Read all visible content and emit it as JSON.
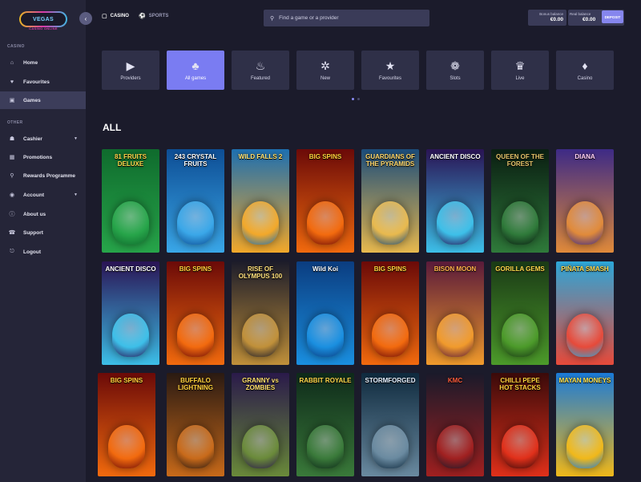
{
  "logo": {
    "text": "VEGAS",
    "sub": "CASINO ONLINE"
  },
  "sidebar": {
    "casino_label": "CASINO",
    "other_label": "OTHER",
    "items": [
      {
        "label": "Home",
        "icon": "home-icon"
      },
      {
        "label": "Favourites",
        "icon": "heart-icon"
      },
      {
        "label": "Games",
        "icon": "games-icon"
      },
      {
        "label": "Cashier",
        "icon": "cashier-icon"
      },
      {
        "label": "Promotions",
        "icon": "gift-icon"
      },
      {
        "label": "Rewards Programme",
        "icon": "trophy-icon"
      },
      {
        "label": "Account",
        "icon": "account-icon"
      },
      {
        "label": "About us",
        "icon": "info-icon"
      },
      {
        "label": "Support",
        "icon": "support-icon"
      },
      {
        "label": "Logout",
        "icon": "logout-icon"
      }
    ]
  },
  "topbar": {
    "casino_tab": "CASINO",
    "sports_tab": "SPORTS",
    "search_placeholder": "Find a game or a provider",
    "bonus_balance_label": "Bonus balance",
    "bonus_balance_value": "€0.00",
    "real_balance_label": "Real balance",
    "real_balance_value": "€0.00",
    "deposit_label": "DEPOSIT"
  },
  "categories": [
    {
      "label": "Providers",
      "icon": "providers-icon"
    },
    {
      "label": "All games",
      "icon": "all-games-icon"
    },
    {
      "label": "Featured",
      "icon": "flame-icon"
    },
    {
      "label": "New",
      "icon": "new-icon"
    },
    {
      "label": "Favourites",
      "icon": "star-icon"
    },
    {
      "label": "Slots",
      "icon": "cherry-icon"
    },
    {
      "label": "Live",
      "icon": "live-icon"
    },
    {
      "label": "Casino",
      "icon": "chips-icon"
    }
  ],
  "section_title": "ALL",
  "games": [
    {
      "title": "81 FRUITS DELUXE",
      "colors": [
        "#0f6b2d",
        "#27a54a"
      ],
      "title_color": "#ffd64a"
    },
    {
      "title": "243 CRYSTAL FRUITS",
      "colors": [
        "#0d4d94",
        "#3aa7e8"
      ],
      "title_color": "#ffffff"
    },
    {
      "title": "WILD FALLS 2",
      "colors": [
        "#1d6fb0",
        "#f2a82a"
      ],
      "title_color": "#ffe170"
    },
    {
      "title": "BIG SPINS",
      "colors": [
        "#6b0a08",
        "#f26a0e"
      ],
      "title_color": "#ffd23c"
    },
    {
      "title": "GUARDIANS OF THE PYRAMIDS",
      "colors": [
        "#1b4c7a",
        "#e8b94e"
      ],
      "title_color": "#ffd76a"
    },
    {
      "title": "ANCIENT DISCO",
      "colors": [
        "#2a1455",
        "#3dbfe8"
      ],
      "title_color": "#ffffff"
    },
    {
      "title": "QUEEN OF THE FOREST",
      "colors": [
        "#0a1e12",
        "#2f7a3a"
      ],
      "title_color": "#e6c36a"
    },
    {
      "title": "DIANA",
      "colors": [
        "#3d2a86",
        "#e08a3a"
      ],
      "title_color": "#ffd0f4"
    },
    {
      "title": "ANCIENT DISCO",
      "colors": [
        "#2a1455",
        "#3dbfe8"
      ],
      "title_color": "#ffffff"
    },
    {
      "title": "BIG SPINS",
      "colors": [
        "#6b0a08",
        "#f26a0e"
      ],
      "title_color": "#ffd23c"
    },
    {
      "title": "RISE OF OLYMPUS 100",
      "colors": [
        "#1c1c2a",
        "#c0903a"
      ],
      "title_color": "#ffe07a"
    },
    {
      "title": "Wild Koi",
      "colors": [
        "#0b3d80",
        "#1a8fe0"
      ],
      "title_color": "#ffffff"
    },
    {
      "title": "BIG SPINS",
      "colors": [
        "#6b0a08",
        "#f26a0e"
      ],
      "title_color": "#ffd23c"
    },
    {
      "title": "BISON MOON",
      "colors": [
        "#5a1a3a",
        "#f09a2c"
      ],
      "title_color": "#ffb34a"
    },
    {
      "title": "GORILLA GEMS",
      "colors": [
        "#1a3a16",
        "#4c9a2a"
      ],
      "title_color": "#ffd64a"
    },
    {
      "title": "PIÑATA SMASH",
      "colors": [
        "#2ca6d8",
        "#e64a3a"
      ],
      "title_color": "#ffd64a"
    },
    {
      "title": "BIG SPINS",
      "colors": [
        "#6b0a08",
        "#f26a0e"
      ],
      "title_color": "#ffd23c"
    },
    {
      "title": "BUFFALO LIGHTNING",
      "colors": [
        "#2a1a12",
        "#c86a1a"
      ],
      "title_color": "#ffd23c"
    },
    {
      "title": "GRANNY vs ZOMBIES",
      "colors": [
        "#2a1a4a",
        "#6a8a3a"
      ],
      "title_color": "#ffe06a"
    },
    {
      "title": "RABBIT ROYALE",
      "colors": [
        "#0e2a1a",
        "#3a7a3a"
      ],
      "title_color": "#ffd64a"
    },
    {
      "title": "STORMFORGED",
      "colors": [
        "#0f2a3e",
        "#6a8aa0"
      ],
      "title_color": "#e6f0ff"
    },
    {
      "title": "KMC",
      "colors": [
        "#1a1a2a",
        "#a02020"
      ],
      "title_color": "#ff5a3a"
    },
    {
      "title": "CHILLI PEPE HOT STACKS",
      "colors": [
        "#3a0a0a",
        "#e0301a"
      ],
      "title_color": "#ffd23c"
    },
    {
      "title": "MAYAN MONEYS",
      "colors": [
        "#1a7ad8",
        "#f0b81a"
      ],
      "title_color": "#ffe04a"
    }
  ],
  "colors": {
    "accent": "#7a7cf2",
    "sidebar_bg": "#252538",
    "page_bg": "#1b1b2b"
  }
}
